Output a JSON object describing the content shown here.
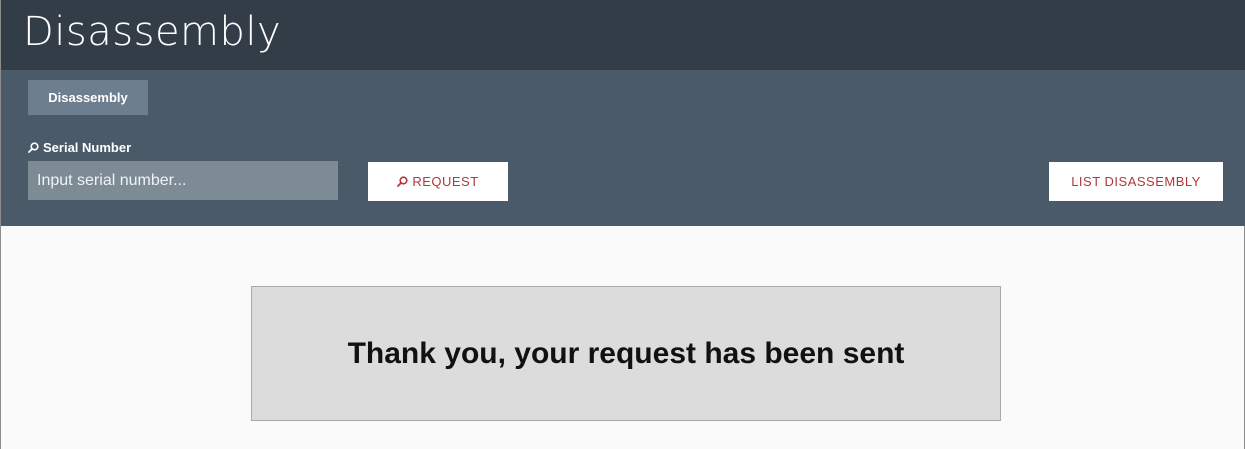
{
  "header": {
    "title": "Disassembly"
  },
  "toolbar": {
    "tab_label": "Disassembly",
    "serial_label": "Serial Number",
    "serial_input": {
      "value": "",
      "placeholder": "Input serial number..."
    },
    "request_label": "REQUEST",
    "list_label": "LIST DISASSEMBLY"
  },
  "message": {
    "text": "Thank you, your request has been sent"
  },
  "colors": {
    "header_bg": "#323d47",
    "toolbar_bg": "#4a5a69",
    "accent": "#b0383a"
  },
  "icons": {
    "search": "search-icon"
  }
}
